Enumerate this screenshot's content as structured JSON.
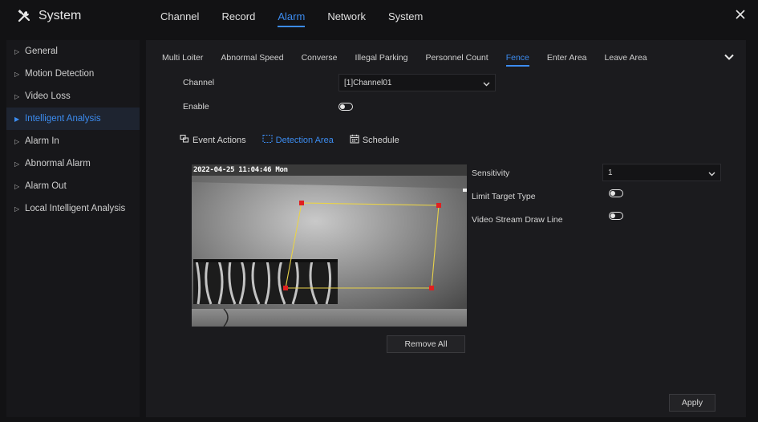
{
  "app": {
    "title": "System"
  },
  "topnav": {
    "items": [
      {
        "label": "Channel",
        "active": false
      },
      {
        "label": "Record",
        "active": false
      },
      {
        "label": "Alarm",
        "active": true
      },
      {
        "label": "Network",
        "active": false
      },
      {
        "label": "System",
        "active": false
      }
    ]
  },
  "sidebar": {
    "items": [
      {
        "label": "General",
        "active": false
      },
      {
        "label": "Motion Detection",
        "active": false
      },
      {
        "label": "Video Loss",
        "active": false
      },
      {
        "label": "Intelligent Analysis",
        "active": true
      },
      {
        "label": "Alarm In",
        "active": false
      },
      {
        "label": "Abnormal Alarm",
        "active": false
      },
      {
        "label": "Alarm Out",
        "active": false
      },
      {
        "label": "Local Intelligent Analysis",
        "active": false
      }
    ]
  },
  "subtabs": {
    "items": [
      {
        "label": "Multi Loiter",
        "active": false
      },
      {
        "label": "Abnormal Speed",
        "active": false
      },
      {
        "label": "Converse",
        "active": false
      },
      {
        "label": "Illegal Parking",
        "active": false
      },
      {
        "label": "Personnel Count",
        "active": false
      },
      {
        "label": "Fence",
        "active": true
      },
      {
        "label": "Enter Area",
        "active": false
      },
      {
        "label": "Leave Area",
        "active": false
      }
    ]
  },
  "form": {
    "channel_label": "Channel",
    "channel_value": "[1]Channel01",
    "enable_label": "Enable",
    "enable_on": false
  },
  "panel_tabs": {
    "event_actions": "Event Actions",
    "detection_area": "Detection Area",
    "schedule": "Schedule",
    "active": "detection_area"
  },
  "video": {
    "osd_timestamp": "2022-04-25 11:04:46 Mon"
  },
  "settings": {
    "sensitivity_label": "Sensitivity",
    "sensitivity_value": "1",
    "limit_target_label": "Limit Target Type",
    "limit_target_on": false,
    "draw_line_label": "Video Stream Draw Line",
    "draw_line_on": false
  },
  "buttons": {
    "remove_all": "Remove All",
    "apply": "Apply"
  },
  "colors": {
    "accent": "#3c8cf0",
    "background": "#121214",
    "panel": "#1b1b1e",
    "area_line": "#e8d24a",
    "area_vertex": "#e02020"
  },
  "icons": {
    "brand": "tools-icon",
    "close": "close-icon",
    "more": "chevron-down-icon",
    "event_actions": "event-actions-icon",
    "detection_area": "dashed-area-icon",
    "schedule": "calendar-icon"
  }
}
